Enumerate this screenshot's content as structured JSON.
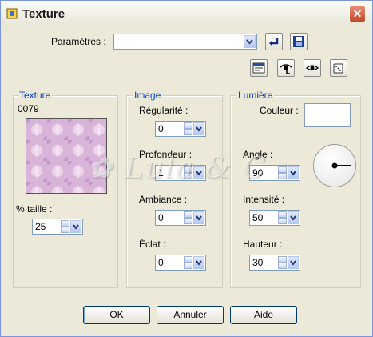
{
  "window": {
    "title": "Texture",
    "close_glyph": "✕"
  },
  "params": {
    "label": "Paramètres :",
    "value": ""
  },
  "texture_group": {
    "title": "Texture",
    "code": "0079",
    "size_label": "% taille :",
    "size_value": "25"
  },
  "image_group": {
    "title": "Image",
    "regularity": {
      "label": "Régularité :",
      "value": "0"
    },
    "depth": {
      "label": "Profondeur :",
      "value": "1"
    },
    "ambiance": {
      "label": "Ambiance :",
      "value": "0"
    },
    "shine": {
      "label": "Éclat :",
      "value": "0"
    }
  },
  "light_group": {
    "title": "Lumière",
    "color_label": "Couleur :",
    "color_value": "#ffffff",
    "angle": {
      "label": "Angle :",
      "value": "90"
    },
    "intensity": {
      "label": "Intensité :",
      "value": "50"
    },
    "height": {
      "label": "Hauteur :",
      "value": "30"
    }
  },
  "buttons": {
    "ok": "OK",
    "cancel": "Annuler",
    "help": "Aide"
  },
  "icons": {
    "reset": "undo-arrow-icon",
    "save": "save-disk-icon",
    "preview": "preview-window-icon",
    "eye1": "eye-toggle-icon",
    "eye2": "eye-icon",
    "random": "dice-icon"
  },
  "accent": "#0046d5"
}
